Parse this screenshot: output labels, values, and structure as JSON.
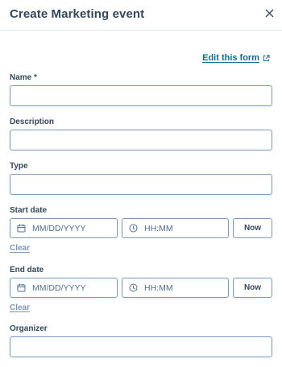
{
  "header": {
    "title": "Create Marketing event"
  },
  "edit_form_link": "Edit this form",
  "fields": {
    "name": {
      "label": "Name *",
      "value": ""
    },
    "description": {
      "label": "Description",
      "value": ""
    },
    "type": {
      "label": "Type",
      "value": ""
    },
    "start_date": {
      "label": "Start date",
      "date_placeholder": "MM/DD/YYYY",
      "time_placeholder": "HH:MM",
      "now_label": "Now",
      "clear_label": "Clear"
    },
    "end_date": {
      "label": "End date",
      "date_placeholder": "MM/DD/YYYY",
      "time_placeholder": "HH:MM",
      "now_label": "Now",
      "clear_label": "Clear"
    },
    "organizer": {
      "label": "Organizer",
      "value": ""
    }
  },
  "icons": {
    "close": "close-icon",
    "external": "external-link-icon",
    "calendar": "calendar-icon",
    "clock": "clock-icon"
  },
  "colors": {
    "text": "#33475b",
    "border": "#7c98b6",
    "link": "#0b6e8e",
    "muted": "#7c98b6"
  }
}
